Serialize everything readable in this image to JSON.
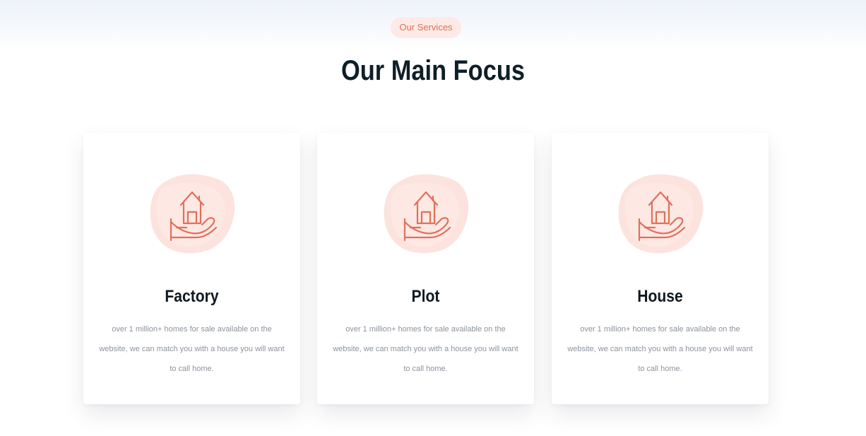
{
  "section": {
    "badge": "Our Services",
    "title": "Our Main Focus"
  },
  "cards": [
    {
      "icon": "house-in-hand-icon",
      "title": "Factory",
      "description": "over 1 million+ homes for sale available on the website, we can match you with a house you will want to call home."
    },
    {
      "icon": "house-in-hand-icon",
      "title": "Plot",
      "description": "over 1 million+ homes for sale available on the website, we can match you with a house you will want to call home."
    },
    {
      "icon": "house-in-hand-icon",
      "title": "House",
      "description": "over 1 million+ homes for sale available on the website, we can match you with a house you will want to call home."
    }
  ],
  "colors": {
    "accent": "#e0705b",
    "badge_bg": "#fdeae6",
    "heading": "#0f1f28",
    "body_text": "#8c939c",
    "blob": "#fbd9d1"
  }
}
